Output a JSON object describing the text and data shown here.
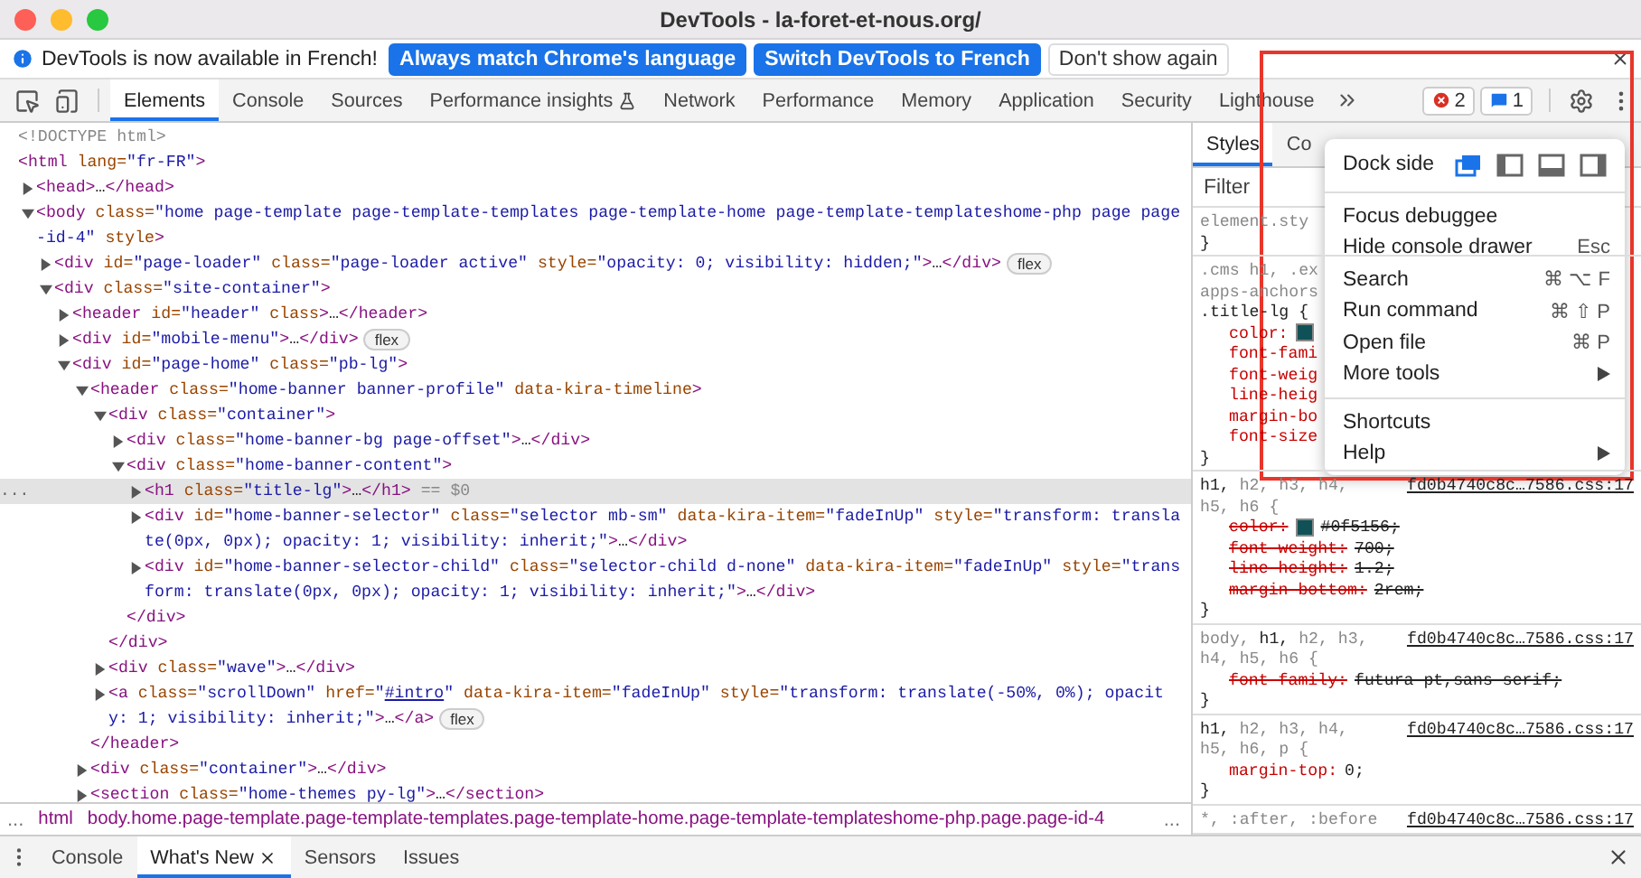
{
  "window": {
    "title": "DevTools - la-foret-et-nous.org/"
  },
  "infobar": {
    "message": "DevTools is now available in French!",
    "buttons": [
      {
        "label": "Always match Chrome's language",
        "kind": "primary"
      },
      {
        "label": "Switch DevTools to French",
        "kind": "primary"
      },
      {
        "label": "Don't show again",
        "kind": "secondary"
      }
    ]
  },
  "toolbar": {
    "tabs": [
      {
        "label": "Elements",
        "selected": true,
        "experimental": false
      },
      {
        "label": "Console",
        "selected": false,
        "experimental": false
      },
      {
        "label": "Sources",
        "selected": false,
        "experimental": false
      },
      {
        "label": "Performance insights",
        "selected": false,
        "experimental": true
      },
      {
        "label": "Network",
        "selected": false,
        "experimental": false
      },
      {
        "label": "Performance",
        "selected": false,
        "experimental": false
      },
      {
        "label": "Memory",
        "selected": false,
        "experimental": false
      },
      {
        "label": "Application",
        "selected": false,
        "experimental": false
      },
      {
        "label": "Security",
        "selected": false,
        "experimental": false
      },
      {
        "label": "Lighthouse",
        "selected": false,
        "experimental": false
      }
    ],
    "errors": "2",
    "messages": "1"
  },
  "elements": {
    "nodes": [
      {
        "lines": [
          [
            {
              "kind": "muted",
              "text": "<!DOCTYPE html>"
            }
          ]
        ]
      },
      {
        "lines": [
          [
            {
              "kind": "tag",
              "text": "<html"
            },
            {
              "kind": "attr",
              "text": " lang="
            },
            {
              "kind": "value",
              "text": "\"fr-FR\""
            },
            {
              "kind": "tag",
              "text": ">"
            }
          ]
        ],
        "children": [
          {
            "expanded": false,
            "selected": false,
            "lines": [
              [
                {
                  "kind": "tag",
                  "text": "<head>"
                },
                {
                  "kind": "text",
                  "text": "…"
                },
                {
                  "kind": "tag",
                  "text": "</head>"
                }
              ]
            ]
          },
          {
            "expanded": true,
            "selected": false,
            "lines": [
              [
                {
                  "kind": "tag",
                  "text": "<body"
                },
                {
                  "kind": "attr",
                  "text": " class="
                },
                {
                  "kind": "value",
                  "text": "\"home page-template page-template-templates page-template-home page-template-templateshome-php page page"
                }
              ],
              [
                {
                  "kind": "value",
                  "text": "-id-4\""
                },
                {
                  "kind": "attr",
                  "text": " style"
                },
                {
                  "kind": "tag",
                  "text": ">"
                }
              ]
            ],
            "children": [
              {
                "expanded": false,
                "selected": false,
                "badge": "flex",
                "lines": [
                  [
                    {
                      "kind": "tag",
                      "text": "<div"
                    },
                    {
                      "kind": "attr",
                      "text": " id="
                    },
                    {
                      "kind": "value",
                      "text": "\"page-loader\""
                    },
                    {
                      "kind": "attr",
                      "text": " class="
                    },
                    {
                      "kind": "value",
                      "text": "\"page-loader active\""
                    },
                    {
                      "kind": "attr",
                      "text": " style="
                    },
                    {
                      "kind": "value",
                      "text": "\"opacity: 0; visibility: hidden;\""
                    },
                    {
                      "kind": "tag",
                      "text": ">"
                    },
                    {
                      "kind": "text",
                      "text": "…"
                    },
                    {
                      "kind": "tag",
                      "text": "</div>"
                    }
                  ]
                ]
              },
              {
                "expanded": true,
                "selected": false,
                "lines": [
                  [
                    {
                      "kind": "tag",
                      "text": "<div"
                    },
                    {
                      "kind": "attr",
                      "text": " class="
                    },
                    {
                      "kind": "value",
                      "text": "\"site-container\""
                    },
                    {
                      "kind": "tag",
                      "text": ">"
                    }
                  ]
                ],
                "children": [
                  {
                    "expanded": false,
                    "selected": false,
                    "lines": [
                      [
                        {
                          "kind": "tag",
                          "text": "<header"
                        },
                        {
                          "kind": "attr",
                          "text": " id="
                        },
                        {
                          "kind": "value",
                          "text": "\"header\""
                        },
                        {
                          "kind": "attr",
                          "text": " class"
                        },
                        {
                          "kind": "tag",
                          "text": ">"
                        },
                        {
                          "kind": "text",
                          "text": "…"
                        },
                        {
                          "kind": "tag",
                          "text": "</header>"
                        }
                      ]
                    ]
                  },
                  {
                    "expanded": false,
                    "selected": false,
                    "badge": "flex",
                    "lines": [
                      [
                        {
                          "kind": "tag",
                          "text": "<div"
                        },
                        {
                          "kind": "attr",
                          "text": " id="
                        },
                        {
                          "kind": "value",
                          "text": "\"mobile-menu\""
                        },
                        {
                          "kind": "tag",
                          "text": ">"
                        },
                        {
                          "kind": "text",
                          "text": "…"
                        },
                        {
                          "kind": "tag",
                          "text": "</div>"
                        }
                      ]
                    ]
                  },
                  {
                    "expanded": true,
                    "selected": false,
                    "lines": [
                      [
                        {
                          "kind": "tag",
                          "text": "<div"
                        },
                        {
                          "kind": "attr",
                          "text": " id="
                        },
                        {
                          "kind": "value",
                          "text": "\"page-home\""
                        },
                        {
                          "kind": "attr",
                          "text": " class="
                        },
                        {
                          "kind": "value",
                          "text": "\"pb-lg\""
                        },
                        {
                          "kind": "tag",
                          "text": ">"
                        }
                      ]
                    ],
                    "children": [
                      {
                        "expanded": true,
                        "selected": false,
                        "closing": "</header>",
                        "lines": [
                          [
                            {
                              "kind": "tag",
                              "text": "<header"
                            },
                            {
                              "kind": "attr",
                              "text": " class="
                            },
                            {
                              "kind": "value",
                              "text": "\"home-banner banner-profile\""
                            },
                            {
                              "kind": "attr",
                              "text": " data-kira-timeline"
                            },
                            {
                              "kind": "tag",
                              "text": ">"
                            }
                          ]
                        ],
                        "children": [
                          {
                            "expanded": true,
                            "selected": false,
                            "closing": "</div>",
                            "lines": [
                              [
                                {
                                  "kind": "tag",
                                  "text": "<div"
                                },
                                {
                                  "kind": "attr",
                                  "text": " class="
                                },
                                {
                                  "kind": "value",
                                  "text": "\"container\""
                                },
                                {
                                  "kind": "tag",
                                  "text": ">"
                                }
                              ]
                            ],
                            "children": [
                              {
                                "expanded": false,
                                "selected": false,
                                "lines": [
                                  [
                                    {
                                      "kind": "tag",
                                      "text": "<div"
                                    },
                                    {
                                      "kind": "attr",
                                      "text": " class="
                                    },
                                    {
                                      "kind": "value",
                                      "text": "\"home-banner-bg page-offset\""
                                    },
                                    {
                                      "kind": "tag",
                                      "text": ">"
                                    },
                                    {
                                      "kind": "text",
                                      "text": "…"
                                    },
                                    {
                                      "kind": "tag",
                                      "text": "</div>"
                                    }
                                  ]
                                ]
                              },
                              {
                                "expanded": true,
                                "selected": false,
                                "closing": "</div>",
                                "lines": [
                                  [
                                    {
                                      "kind": "tag",
                                      "text": "<div"
                                    },
                                    {
                                      "kind": "attr",
                                      "text": " class="
                                    },
                                    {
                                      "kind": "value",
                                      "text": "\"home-banner-content\""
                                    },
                                    {
                                      "kind": "tag",
                                      "text": ">"
                                    }
                                  ]
                                ],
                                "children": [
                                  {
                                    "expanded": false,
                                    "selected": true,
                                    "gutter": "...",
                                    "lines": [
                                      [
                                        {
                                          "kind": "tag",
                                          "text": "<h1"
                                        },
                                        {
                                          "kind": "attr",
                                          "text": " class="
                                        },
                                        {
                                          "kind": "value",
                                          "text": "\"title-lg\""
                                        },
                                        {
                                          "kind": "tag",
                                          "text": ">"
                                        },
                                        {
                                          "kind": "text",
                                          "text": "…"
                                        },
                                        {
                                          "kind": "tag",
                                          "text": "</h1>"
                                        },
                                        {
                                          "kind": "muted",
                                          "text": " == $0"
                                        }
                                      ]
                                    ]
                                  },
                                  {
                                    "expanded": false,
                                    "selected": false,
                                    "lines": [
                                      [
                                        {
                                          "kind": "tag",
                                          "text": "<div"
                                        },
                                        {
                                          "kind": "attr",
                                          "text": " id="
                                        },
                                        {
                                          "kind": "value",
                                          "text": "\"home-banner-selector\""
                                        },
                                        {
                                          "kind": "attr",
                                          "text": " class="
                                        },
                                        {
                                          "kind": "value",
                                          "text": "\"selector mb-sm\""
                                        },
                                        {
                                          "kind": "attr",
                                          "text": " data-kira-item="
                                        },
                                        {
                                          "kind": "value",
                                          "text": "\"fadeInUp\""
                                        },
                                        {
                                          "kind": "attr",
                                          "text": " style="
                                        },
                                        {
                                          "kind": "value",
                                          "text": "\"transform: transla"
                                        }
                                      ],
                                      [
                                        {
                                          "kind": "value",
                                          "text": "te(0px, 0px); opacity: 1; visibility: inherit;\""
                                        },
                                        {
                                          "kind": "tag",
                                          "text": ">"
                                        },
                                        {
                                          "kind": "text",
                                          "text": "…"
                                        },
                                        {
                                          "kind": "tag",
                                          "text": "</div>"
                                        }
                                      ]
                                    ]
                                  },
                                  {
                                    "expanded": false,
                                    "selected": false,
                                    "lines": [
                                      [
                                        {
                                          "kind": "tag",
                                          "text": "<div"
                                        },
                                        {
                                          "kind": "attr",
                                          "text": " id="
                                        },
                                        {
                                          "kind": "value",
                                          "text": "\"home-banner-selector-child\""
                                        },
                                        {
                                          "kind": "attr",
                                          "text": " class="
                                        },
                                        {
                                          "kind": "value",
                                          "text": "\"selector-child d-none\""
                                        },
                                        {
                                          "kind": "attr",
                                          "text": " data-kira-item="
                                        },
                                        {
                                          "kind": "value",
                                          "text": "\"fadeInUp\""
                                        },
                                        {
                                          "kind": "attr",
                                          "text": " style="
                                        },
                                        {
                                          "kind": "value",
                                          "text": "\"trans"
                                        }
                                      ],
                                      [
                                        {
                                          "kind": "value",
                                          "text": "form: translate(0px, 0px); opacity: 1; visibility: inherit;\""
                                        },
                                        {
                                          "kind": "tag",
                                          "text": ">"
                                        },
                                        {
                                          "kind": "text",
                                          "text": "…"
                                        },
                                        {
                                          "kind": "tag",
                                          "text": "</div>"
                                        }
                                      ]
                                    ]
                                  }
                                ]
                              }
                            ]
                          },
                          {
                            "expanded": false,
                            "selected": false,
                            "lines": [
                              [
                                {
                                  "kind": "tag",
                                  "text": "<div"
                                },
                                {
                                  "kind": "attr",
                                  "text": " class="
                                },
                                {
                                  "kind": "value",
                                  "text": "\"wave\""
                                },
                                {
                                  "kind": "tag",
                                  "text": ">"
                                },
                                {
                                  "kind": "text",
                                  "text": "…"
                                },
                                {
                                  "kind": "tag",
                                  "text": "</div>"
                                }
                              ]
                            ]
                          },
                          {
                            "expanded": false,
                            "selected": false,
                            "badge": "flex",
                            "lines": [
                              [
                                {
                                  "kind": "tag",
                                  "text": "<a"
                                },
                                {
                                  "kind": "attr",
                                  "text": " class="
                                },
                                {
                                  "kind": "value",
                                  "text": "\"scrollDown\""
                                },
                                {
                                  "kind": "attr",
                                  "text": " href="
                                },
                                {
                                  "kind": "value",
                                  "text": "\""
                                },
                                {
                                  "kind": "link",
                                  "text": "#intro"
                                },
                                {
                                  "kind": "value",
                                  "text": "\""
                                },
                                {
                                  "kind": "attr",
                                  "text": " data-kira-item="
                                },
                                {
                                  "kind": "value",
                                  "text": "\"fadeInUp\""
                                },
                                {
                                  "kind": "attr",
                                  "text": " style="
                                },
                                {
                                  "kind": "value",
                                  "text": "\"transform: translate(-50%, 0%); opacit"
                                }
                              ],
                              [
                                {
                                  "kind": "value",
                                  "text": "y: 1; visibility: inherit;\""
                                },
                                {
                                  "kind": "tag",
                                  "text": ">"
                                },
                                {
                                  "kind": "text",
                                  "text": "…"
                                },
                                {
                                  "kind": "tag",
                                  "text": "</a>"
                                }
                              ]
                            ]
                          }
                        ]
                      },
                      {
                        "expanded": false,
                        "selected": false,
                        "lines": [
                          [
                            {
                              "kind": "tag",
                              "text": "<div"
                            },
                            {
                              "kind": "attr",
                              "text": " class="
                            },
                            {
                              "kind": "value",
                              "text": "\"container\""
                            },
                            {
                              "kind": "tag",
                              "text": ">"
                            },
                            {
                              "kind": "text",
                              "text": "…"
                            },
                            {
                              "kind": "tag",
                              "text": "</div>"
                            }
                          ]
                        ]
                      },
                      {
                        "expanded": false,
                        "selected": false,
                        "lines": [
                          [
                            {
                              "kind": "tag",
                              "text": "<section"
                            },
                            {
                              "kind": "attr",
                              "text": " class="
                            },
                            {
                              "kind": "value",
                              "text": "\"home-themes py-lg\""
                            },
                            {
                              "kind": "tag",
                              "text": ">"
                            },
                            {
                              "kind": "text",
                              "text": "…"
                            },
                            {
                              "kind": "tag",
                              "text": "</section>"
                            }
                          ]
                        ]
                      }
                    ]
                  }
                ]
              }
            ]
          }
        ]
      }
    ]
  },
  "styles": {
    "tabs": [
      {
        "label": "Styles",
        "selected": true
      },
      {
        "label": "Co",
        "selected": false
      }
    ],
    "filter": {
      "placeholder": "Filter"
    },
    "rules": [
      {
        "selector_lines": [
          [
            {
              "text": "element.sty",
              "matched": false
            }
          ]
        ],
        "closing": "}"
      },
      {
        "selector_lines": [
          [
            {
              "text": ".cms h1, .ex",
              "matched": false
            }
          ],
          [
            {
              "text": "apps-anchors",
              "matched": false
            }
          ],
          [
            {
              "text": ".title-lg {",
              "matched": true
            }
          ]
        ],
        "declarations": [
          {
            "name": "color:",
            "color": "#0f5156",
            "overridden": false
          },
          {
            "name": "font-fami",
            "overridden": false
          },
          {
            "name": "font-weig",
            "overridden": false
          },
          {
            "name": "line-heig",
            "overridden": false
          },
          {
            "name": "margin-bo",
            "overridden": false
          },
          {
            "name": "font-size",
            "overridden": false
          }
        ],
        "closing": "}"
      },
      {
        "source": "fd0b4740c8c…7586.css:17",
        "selector_lines": [
          [
            {
              "text": "h1, ",
              "matched": true
            },
            {
              "text": "h2, h3, h4,",
              "matched": false
            }
          ],
          [
            {
              "text": "h5, h6 {",
              "matched": false
            }
          ]
        ],
        "declarations": [
          {
            "name": "color:",
            "color": "#0f5156",
            "value": "#0f5156;",
            "overridden": true
          },
          {
            "name": "font-weight:",
            "value": "700;",
            "overridden": true
          },
          {
            "name": "line-height:",
            "value": "1.2;",
            "overridden": true
          },
          {
            "name": "margin-bottom:",
            "value": "2rem;",
            "overridden": true
          }
        ],
        "closing": "}"
      },
      {
        "source": "fd0b4740c8c…7586.css:17",
        "selector_lines": [
          [
            {
              "text": "body, ",
              "matched": false
            },
            {
              "text": "h1, ",
              "matched": true
            },
            {
              "text": "h2, h3,",
              "matched": false
            }
          ],
          [
            {
              "text": "h4, h5, h6 {",
              "matched": false
            }
          ]
        ],
        "declarations": [
          {
            "name": "font-family:",
            "value": "futura-pt,sans-serif;",
            "overridden": true
          }
        ],
        "closing": "}"
      },
      {
        "source": "fd0b4740c8c…7586.css:17",
        "selector_lines": [
          [
            {
              "text": "h1, ",
              "matched": true
            },
            {
              "text": "h2, h3, h4,",
              "matched": false
            }
          ],
          [
            {
              "text": "h5, h6, p {",
              "matched": false
            }
          ]
        ],
        "declarations": [
          {
            "name": "margin-top:",
            "value": "0;",
            "overridden": false
          }
        ],
        "closing": "}"
      },
      {
        "source": "fd0b4740c8c…7586.css:17",
        "selector_lines": [
          [
            {
              "text": "*, :after, :before",
              "matched": false
            }
          ]
        ]
      }
    ]
  },
  "menu": {
    "dock": {
      "label": "Dock side",
      "options": [
        {
          "kind": "undock",
          "selected": true
        },
        {
          "kind": "left",
          "selected": false
        },
        {
          "kind": "bottom",
          "selected": false
        },
        {
          "kind": "right",
          "selected": false
        }
      ]
    },
    "sections": [
      [
        {
          "label": "Focus debuggee",
          "submenu": false
        },
        {
          "label": "Hide console drawer",
          "shortcut": "Esc",
          "submenu": false
        },
        {
          "label": "Search",
          "shortcut": "⌘ ⌥ F",
          "submenu": false
        },
        {
          "label": "Run command",
          "shortcut": "⌘ ⇧ P",
          "submenu": false
        },
        {
          "label": "Open file",
          "shortcut": "⌘ P",
          "submenu": false
        },
        {
          "label": "More tools",
          "submenu": true
        }
      ],
      [
        {
          "label": "Shortcuts",
          "submenu": false
        },
        {
          "label": "Help",
          "submenu": true
        }
      ]
    ]
  },
  "breadcrumbs": {
    "overflow_left": "...",
    "items": [
      "html",
      "body.home.page-template.page-template-templates.page-template-home.page-template-templateshome-php.page.page-id-4"
    ],
    "overflow_right": "..."
  },
  "drawer": {
    "tabs": [
      {
        "label": "Console",
        "selected": false,
        "closable": false
      },
      {
        "label": "What's New",
        "selected": true,
        "closable": true
      },
      {
        "label": "Sensors",
        "selected": false,
        "closable": false
      },
      {
        "label": "Issues",
        "selected": false,
        "closable": false
      }
    ]
  }
}
